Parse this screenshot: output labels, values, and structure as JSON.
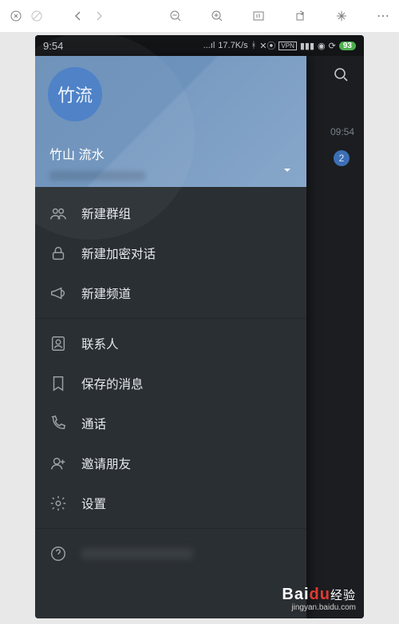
{
  "browser": {
    "dots": "⋯"
  },
  "statusbar": {
    "time": "9:54",
    "speed": "17.7K/s",
    "battery": "93"
  },
  "appshadow": {
    "time": "09:54",
    "badge": "2"
  },
  "drawer": {
    "avatar_text": "竹流",
    "name": "竹山 流水",
    "items": [
      {
        "label": "新建群组",
        "icon": "group-icon"
      },
      {
        "label": "新建加密对话",
        "icon": "lock-icon"
      },
      {
        "label": "新建频道",
        "icon": "megaphone-icon"
      }
    ],
    "items2": [
      {
        "label": "联系人",
        "icon": "contact-icon"
      },
      {
        "label": "保存的消息",
        "icon": "bookmark-icon"
      },
      {
        "label": "通话",
        "icon": "phone-icon"
      },
      {
        "label": "邀请朋友",
        "icon": "adduser-icon"
      },
      {
        "label": "设置",
        "icon": "gear-icon"
      }
    ]
  },
  "watermark": {
    "brand_a": "Bai",
    "brand_b": "du",
    "brand_c": "经验",
    "url": "jingyan.baidu.com"
  }
}
